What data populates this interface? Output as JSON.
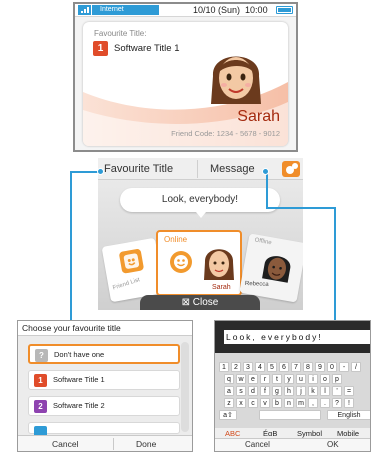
{
  "top_screen": {
    "status": {
      "network_label": "Internet",
      "date": "10/10 (Sun)",
      "time": "10:00"
    },
    "profile": {
      "favourite_title_label": "Favourite Title:",
      "software_badge": "1",
      "software_title": "Software Title 1",
      "user_name": "Sarah",
      "friend_code": "Friend Code: 1234 - 5678 - 9012"
    }
  },
  "bottom_screen": {
    "tabs": {
      "favourite_title": "Favourite Title",
      "message": "Message"
    },
    "message_bubble": "Look, everybody!",
    "friend_list_label": "Friend List",
    "online_label": "Online",
    "offline_label": "Offline",
    "friends": [
      "Sarah",
      "Rebecca"
    ],
    "close_label": "Close"
  },
  "choose_panel": {
    "title": "Choose your favourite title",
    "items": [
      {
        "badge": "?",
        "label": "Don't have one",
        "color": "#b8b8b8",
        "selected": true
      },
      {
        "badge": "1",
        "label": "Software Title 1",
        "color": "#e04c2a",
        "selected": false
      },
      {
        "badge": "2",
        "label": "Software Title 2",
        "color": "#8e43b0",
        "selected": false
      }
    ],
    "cancel_label": "Cancel",
    "done_label": "Done"
  },
  "keyboard_panel": {
    "typed_text": "Look, everybody!",
    "rows": [
      [
        "1",
        "2",
        "3",
        "4",
        "5",
        "6",
        "7",
        "8",
        "9",
        "0",
        "-",
        "/"
      ],
      [
        "q",
        "w",
        "e",
        "r",
        "t",
        "y",
        "u",
        "i",
        "o",
        "p"
      ],
      [
        "a",
        "s",
        "d",
        "f",
        "g",
        "h",
        "j",
        "k",
        "l",
        "'",
        "="
      ],
      [
        "z",
        "x",
        "c",
        "v",
        "b",
        "n",
        "m",
        ",",
        ".",
        "?",
        "!"
      ]
    ],
    "modes": [
      "ABC",
      "ÉαΒ",
      "Symbol",
      "Mobile"
    ],
    "language": "English",
    "cancel_label": "Cancel",
    "ok_label": "OK"
  },
  "colors": {
    "accent_blue": "#2e9bd6",
    "accent_orange": "#f08d2a",
    "name_red": "#a42a0f"
  }
}
